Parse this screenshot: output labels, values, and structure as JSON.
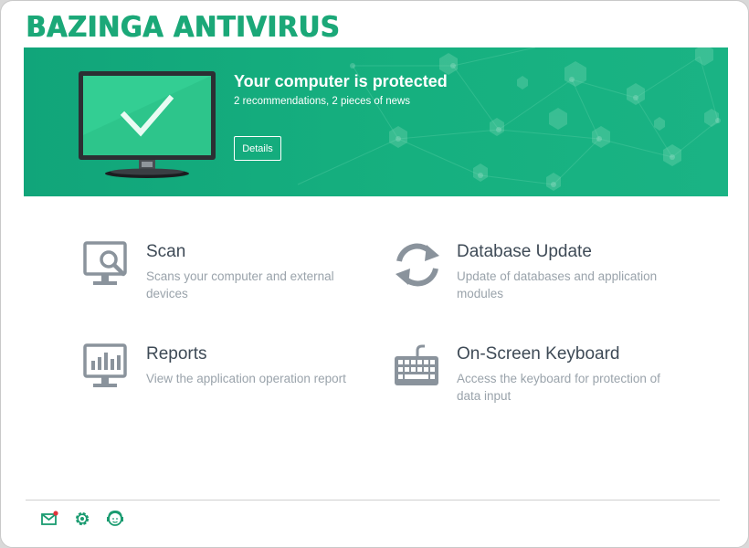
{
  "app": {
    "title": "BAZINGA ANTIVIRUS"
  },
  "status": {
    "title": "Your computer is protected",
    "subtitle": "2 recommendations, 2 pieces of news",
    "details_label": "Details"
  },
  "tiles": [
    {
      "name": "Scan",
      "description": "Scans your computer and external devices",
      "icon": "scan-monitor-icon"
    },
    {
      "name": "Database Update",
      "description": "Update of databases and application modules",
      "icon": "refresh-icon"
    },
    {
      "name": "Reports",
      "description": "View the application operation report",
      "icon": "report-monitor-icon"
    },
    {
      "name": "On-Screen Keyboard",
      "description": "Access the keyboard for protection of data input",
      "icon": "keyboard-icon"
    }
  ],
  "footer": {
    "icons": [
      "mail-notification-icon",
      "settings-gear-icon",
      "support-icon"
    ]
  },
  "colors": {
    "brand_green": "#1ba878",
    "banner_green": "#16b07f",
    "icon_gray": "#8a939c",
    "title_text": "#3e4a56",
    "desc_text": "#9aa3ab",
    "notification_red": "#e0343c"
  }
}
